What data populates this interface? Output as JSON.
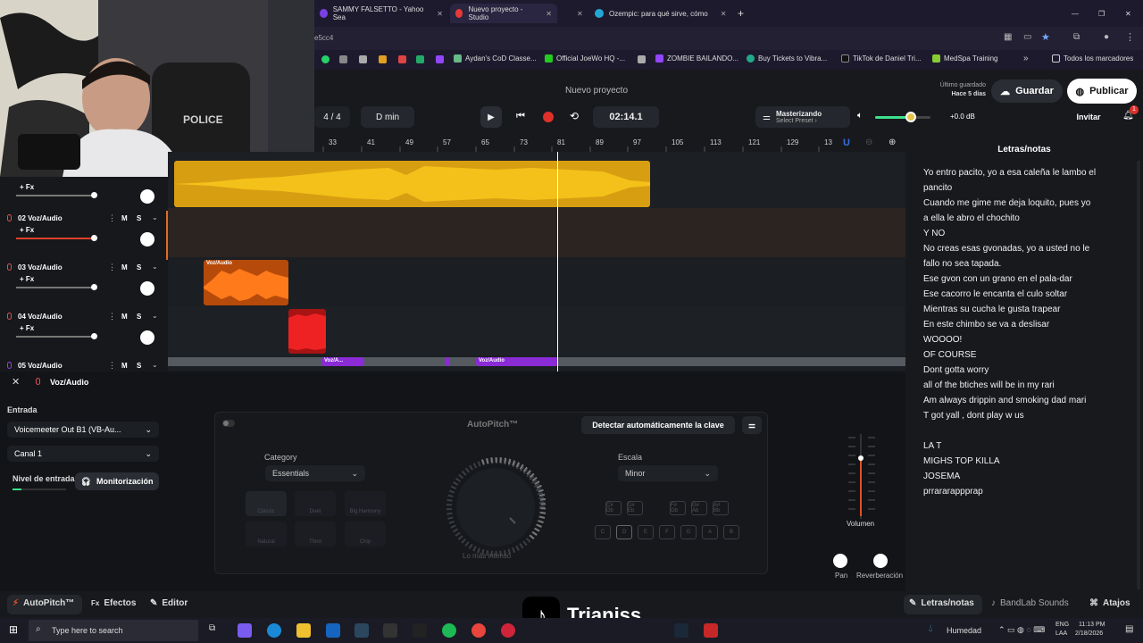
{
  "browser": {
    "tabs": [
      {
        "label": "SAMMY FALSETTO - Yahoo Sea"
      },
      {
        "label": "Nuevo proyecto - Studio"
      },
      {
        "label": ""
      },
      {
        "label": "Ozempic: para qué sirve, cómo"
      }
    ],
    "address": "e5cc4",
    "bookmarks": [
      {
        "label": "Aydan's CoD Classe..."
      },
      {
        "label": "Official JoeWo HQ -..."
      },
      {
        "label": "ZOMBIE BAILANDO..."
      },
      {
        "label": "Buy Tickets to Vibra..."
      },
      {
        "label": "TikTok de Daniel Tri..."
      },
      {
        "label": "MedSpa Training"
      },
      {
        "label": "Todos los marcadores"
      }
    ]
  },
  "header": {
    "project_title": "Nuevo proyecto",
    "last_saved_label": "Último guardado",
    "last_saved_value": "Hace 5 días",
    "save_label": "Guardar",
    "publish_label": "Publicar",
    "invite_label": "Invitar",
    "notifications_count": "1",
    "time_signature": "4 / 4",
    "key": "D min",
    "time": "02:14.1",
    "mastering_title": "Masterizando",
    "mastering_sub": "Select Preset ›",
    "master_volume": "+0.0 dB",
    "master_volume_level": 0.65
  },
  "ruler": {
    "ticks": [
      "33",
      "41",
      "49",
      "57",
      "65",
      "73",
      "81",
      "89",
      "97",
      "105",
      "113",
      "121",
      "129",
      "13"
    ]
  },
  "tracks": [
    {
      "name": "",
      "fx": "+ Fx",
      "mute": "",
      "solo": ""
    },
    {
      "name": "02 Voz/Audio",
      "fx": "+ Fx",
      "mute": "M",
      "solo": "S"
    },
    {
      "name": "03 Voz/Audio",
      "fx": "+ Fx",
      "mute": "M",
      "solo": "S"
    },
    {
      "name": "04 Voz/Audio",
      "fx": "+ Fx",
      "mute": "M",
      "solo": "S"
    },
    {
      "name": "05 Voz/Audio",
      "fx": "",
      "mute": "M",
      "solo": "S"
    }
  ],
  "clips": {
    "c3": "Voz/Audio",
    "c5a": "Voz/A...",
    "c5b": "Voz/Audio"
  },
  "lower": {
    "panel_title": "Voz/Audio",
    "input_label": "Entrada",
    "input_device": "Voicemeeter Out B1 (VB-Au...",
    "channel": "Canal 1",
    "input_level_label": "Nivel de entrada",
    "monitoring_label": "Monitorización",
    "autopitch_title": "AutoPitch™",
    "detect_key_label": "Detectar automáticamente la clave",
    "category_label": "Category",
    "category_value": "Essentials",
    "scale_label": "Escala",
    "scale_value": "Minor",
    "knob_caption": "Lo más intenso",
    "styles": [
      "Classic",
      "Duet",
      "Big Harmony",
      "Natural",
      "Third",
      "Chip"
    ],
    "sharp_keys": [
      "C# Db",
      "D# Eb",
      "F# Gb",
      "G# Ab",
      "A# Bb"
    ],
    "natural_keys": [
      "C",
      "D",
      "E",
      "F",
      "G",
      "A",
      "B"
    ],
    "volume_label": "Volumen",
    "pan_label": "Pan",
    "reverb_label": "Reverberación"
  },
  "lyrics": {
    "title": "Letras/notas",
    "lines": [
      "Yo entro pacito, yo a esa caleña le lambo el",
      "pancito",
      "Cuando me gime me deja loquito, pues yo",
      "a ella le abro el chochito",
      "Y NO",
      "No creas esas gvonadas, yo a usted no le",
      "fallo no sea tapada.",
      "Ese gvon con un grano en el pala-dar",
      "Ese cacorro le encanta el culo soltar",
      "Mientras su cucha le gusta trapear",
      "En este chimbo se va a deslisar",
      "WOOOO!",
      "OF COURSE",
      "Dont gotta worry",
      "all of the btiches will be in my rari",
      "Am always drippin and smoking dad mari",
      "T got yall , dont play w us",
      "",
      "LA T",
      "MIGHS TOP KILLA",
      "JOSEMA",
      "prrararappprap"
    ]
  },
  "bottom": {
    "autopitch": "AutoPitch™",
    "effects": "Efectos",
    "editor": "Editor",
    "lyrics": "Letras/notas",
    "sounds": "BandLab Sounds",
    "shortcuts": "Atajos"
  },
  "taskbar": {
    "search_placeholder": "Type here to search",
    "weather": "Humedad",
    "lang1": "ENG",
    "lang2": "LAA",
    "time": "11:13 PM",
    "date": "2/18/2026"
  },
  "overlay": {
    "tiktok_name": "Trianiss"
  }
}
